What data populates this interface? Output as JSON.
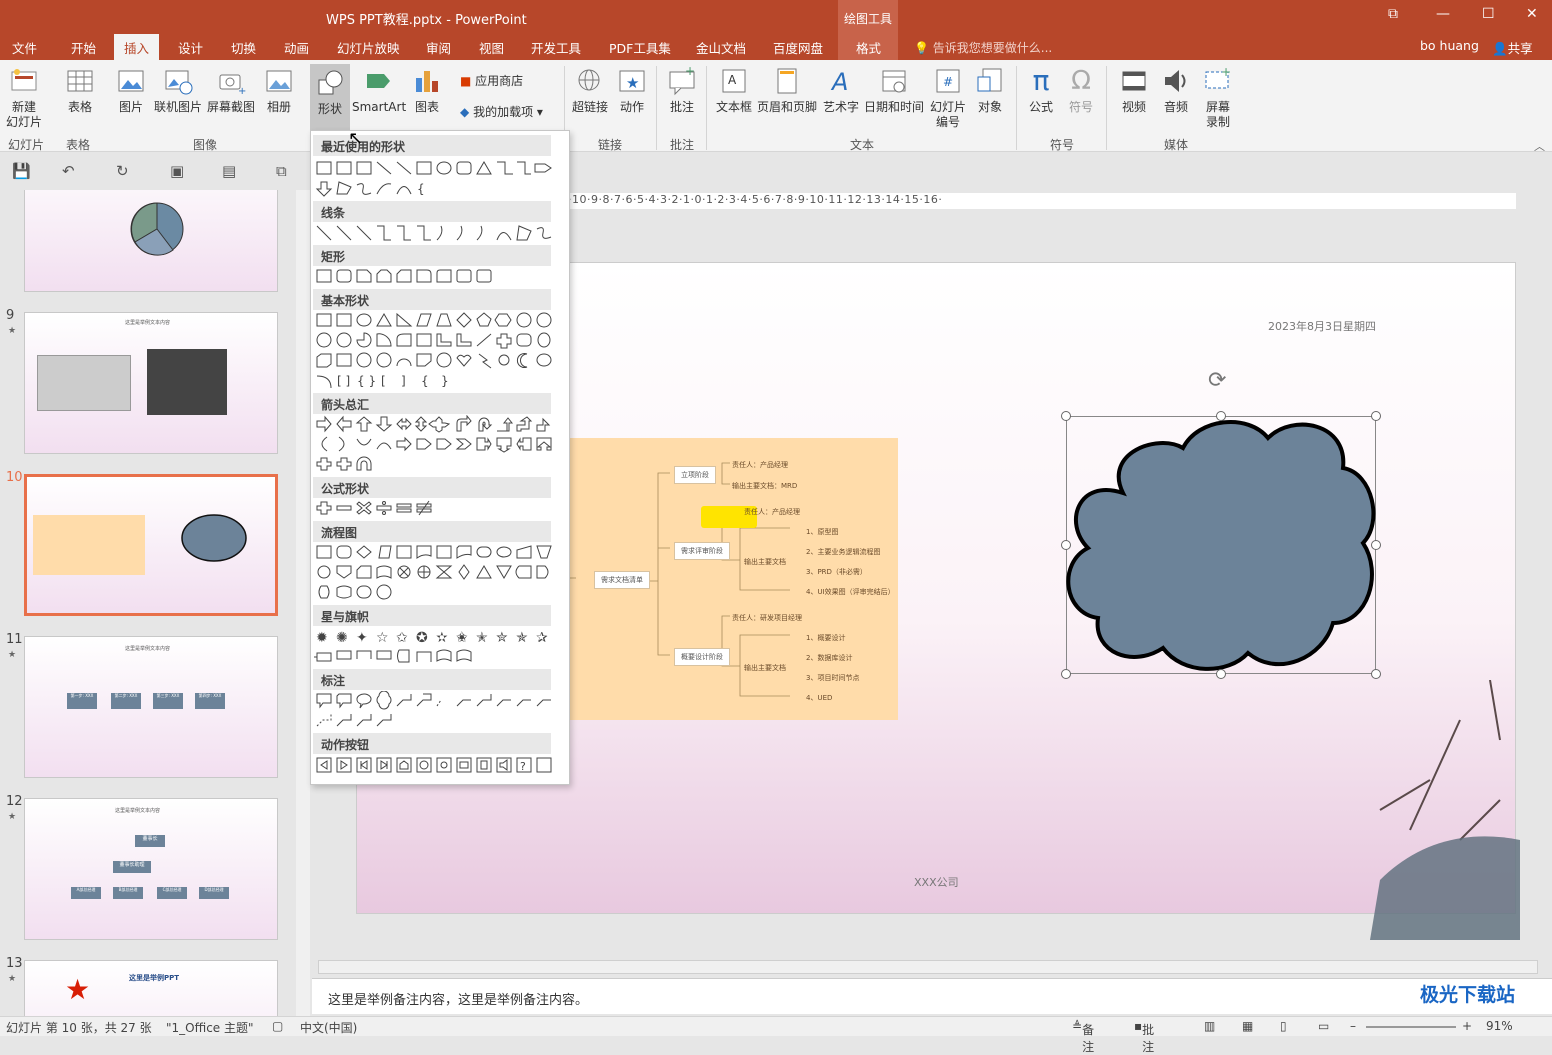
{
  "window": {
    "title": "WPS PPT教程.pptx - PowerPoint",
    "context_group": "绘图工具",
    "context_tab": "格式"
  },
  "tabs": [
    "文件",
    "开始",
    "插入",
    "设计",
    "切换",
    "动画",
    "幻灯片放映",
    "审阅",
    "视图",
    "开发工具",
    "PDF工具集",
    "金山文档",
    "百度网盘"
  ],
  "active_tab": "插入",
  "help_text": "告诉我您想要做什么...",
  "user": "bo huang",
  "share": "共享",
  "ribbon": {
    "new_slide": "新建\n幻灯片",
    "table": "表格",
    "picture": "图片",
    "online_picture": "联机图片",
    "screenshot": "屏幕截图",
    "album": "相册",
    "shapes": "形状",
    "smartart": "SmartArt",
    "chart": "图表",
    "app_store": "应用商店",
    "my_addins": "我的加载项",
    "hyperlink": "超链接",
    "action": "动作",
    "comment": "批注",
    "textbox": "文本框",
    "header_footer": "页眉和页脚",
    "wordart": "艺术字",
    "datetime": "日期和时间",
    "slide_number": "幻灯片\n编号",
    "object": "对象",
    "equation": "公式",
    "symbol": "符号",
    "video": "视频",
    "audio": "音频",
    "screen_record": "屏幕\n录制",
    "groups": [
      "幻灯片",
      "表格",
      "图像",
      "链接",
      "批注",
      "文本",
      "符号",
      "媒体"
    ]
  },
  "shapes_gallery": {
    "sections": [
      "最近使用的形状",
      "线条",
      "矩形",
      "基本形状",
      "箭头总汇",
      "公式形状",
      "流程图",
      "星与旗帜",
      "标注",
      "动作按钮"
    ]
  },
  "slide_thumbs": [
    {
      "num": "",
      "star": false
    },
    {
      "num": "9",
      "star": true,
      "title": "这里是举例文本内容"
    },
    {
      "num": "10",
      "star": false,
      "selected": true
    },
    {
      "num": "11",
      "star": true,
      "title": "这里是举例文本内容",
      "steps": [
        "第一步: XXX",
        "第二步: XXX",
        "第三步: XXX",
        "第四步: XXX"
      ]
    },
    {
      "num": "12",
      "star": true,
      "title": "这里是举例文本内容",
      "org": [
        "董事长",
        "董事长助理",
        "A部总经理",
        "B部总经理",
        "C部总经理",
        "D部总经理"
      ]
    },
    {
      "num": "13",
      "star": true,
      "title": "这里是举例PPT"
    }
  ],
  "slide": {
    "date": "2023年8月3日星期四",
    "company": "XXX公司",
    "mindmap": {
      "center": "需求文档清单",
      "stages": [
        "立项阶段",
        "需求评审阶段",
        "概要设计阶段"
      ],
      "details": [
        "责任人：产品经理",
        "输出主要文档：MRD",
        "责任人：产品经理",
        "输出主要文档",
        "1、原型图",
        "2、主要业务逻辑流程图",
        "3、PRD（非必需）",
        "4、UI效果图（评审完结后）",
        "责任人：研发项目经理",
        "输出主要文档",
        "1、概要设计",
        "2、数据库设计",
        "3、项目时间节点",
        "4、UED"
      ]
    }
  },
  "ruler": "·10·9·8·7·6·5·4·3·2·1·0·1·2·3·4·5·6·7·8·9·10·11·12·13·14·15·16·",
  "notes": "这里是举例备注内容，这里是举例备注内容。",
  "status": {
    "slide_info": "幻灯片 第 10 张，共 27 张",
    "theme": "\"1_Office 主题\"",
    "lang": "中文(中国)",
    "notes_btn": "备注",
    "comments_btn": "批注",
    "zoom": "91%"
  },
  "watermark": "极光下载站",
  "colors": {
    "accent": "#b7472a",
    "cloud": "#6c8399",
    "mindmap_bg": "#ffdcaa",
    "selected_border": "#e8704a"
  }
}
